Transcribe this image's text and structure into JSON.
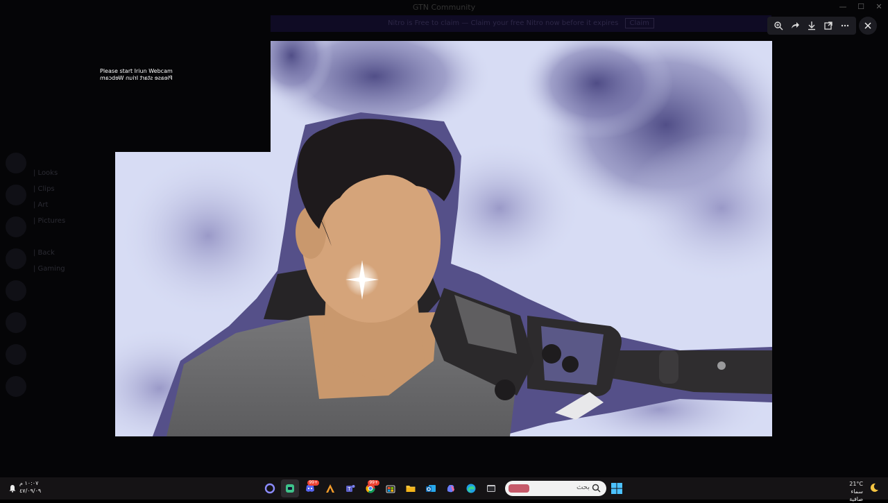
{
  "window": {
    "title": "GTN Community"
  },
  "window_controls": [
    "—",
    "☐",
    "✕"
  ],
  "banner": {
    "text": "Nitro is Free to claim — Claim your free Nitro now before it expires",
    "button": "Claim"
  },
  "viewer_toolbar": {
    "icons": [
      "zoom-in-icon",
      "share-icon",
      "download-icon",
      "open-external-icon",
      "more-icon"
    ],
    "close": "close-icon"
  },
  "webcam_message": {
    "line1": "Please start Iriun Webcam",
    "line2": "Please start Iriun Webcam"
  },
  "channels": [
    "| Looks",
    "| Clips",
    "| Art",
    "| Pictures",
    "",
    "| Back",
    "| Gaming"
  ],
  "members": [
    "",
    "",
    "",
    "",
    "",
    "",
    "",
    "",
    "",
    "",
    "",
    "",
    "",
    "",
    "",
    ""
  ],
  "taskbar": {
    "clock_time": "١٠:٠٧ م",
    "clock_date": "٤٧/٠٩/٠٩",
    "search_placeholder": "بحث",
    "weather_temp": "21°C",
    "weather_desc": "سماء صافية",
    "apps": [
      {
        "name": "cortana-icon",
        "badge": ""
      },
      {
        "name": "discord-app-icon",
        "badge": "",
        "active": true
      },
      {
        "name": "discord-icon",
        "badge": "99+"
      },
      {
        "name": "autodesk-icon",
        "badge": ""
      },
      {
        "name": "teams-icon",
        "badge": ""
      },
      {
        "name": "chrome-icon",
        "badge": "99+"
      },
      {
        "name": "store-icon",
        "badge": ""
      },
      {
        "name": "file-explorer-icon",
        "badge": ""
      },
      {
        "name": "outlook-icon",
        "badge": ""
      },
      {
        "name": "copilot-icon",
        "badge": ""
      },
      {
        "name": "edge-icon",
        "badge": ""
      },
      {
        "name": "terminal-icon",
        "badge": ""
      }
    ]
  },
  "colors": {
    "sky_light": "#d7dcf4",
    "sky_cloud": "#6b6aa1",
    "outline_blue": "#555089",
    "skin": "#c9986d",
    "hair": "#1e1a1c",
    "shirt": "#6c6c6e",
    "mic_arm": "#2f2d2f"
  }
}
